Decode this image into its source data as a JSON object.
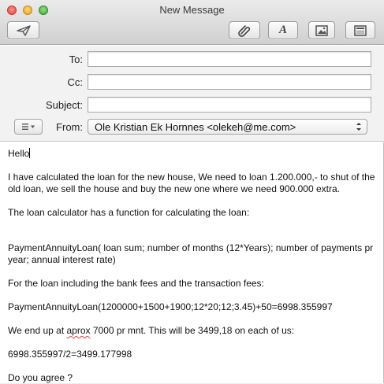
{
  "window": {
    "title": "New Message"
  },
  "toolbar": {
    "send_icon": "paper-plane-icon",
    "attach_icon": "paperclip-icon",
    "font_label": "A",
    "photo_icon": "photo-browser-icon",
    "template_icon": "stationery-icon"
  },
  "header": {
    "to_label": "To:",
    "to_value": "",
    "cc_label": "Cc:",
    "cc_value": "",
    "subject_label": "Subject:",
    "subject_value": "",
    "from_label": "From:",
    "from_value": "Ole Kristian Ek Hornnes <olekeh@me.com>"
  },
  "message": {
    "greeting": "Hello",
    "line1": "I have calculated the loan for the new house, We need to loan 1.200.000,- to shut of the old loan, we sell the house and buy the new one where we need 900.000 extra.",
    "line2": "The loan calculator has a function for calculating the loan:",
    "line3": "PaymentAnnuityLoan( loan sum; number of months (12*Years); number of payments pr year; annual interest rate)",
    "line4": "For the loan including the bank fees and the transaction fees:",
    "line5": "PaymentAnnuityLoan(1200000+1500+1900;12*20;12;3.45)+50=6998.355997",
    "line6_pre": "We end up at ",
    "line6_word": "aprox",
    "line6_post": " 7000 pr mnt. This will be 3499,18 on each of us:",
    "line7": "6998.355997/2=3499.177998",
    "line8": "Do you agree ?"
  },
  "colors": {
    "close": "#e0443e",
    "minimize": "#dea125",
    "maximize": "#3fa63a",
    "spell_underline": "#e23b3b"
  }
}
